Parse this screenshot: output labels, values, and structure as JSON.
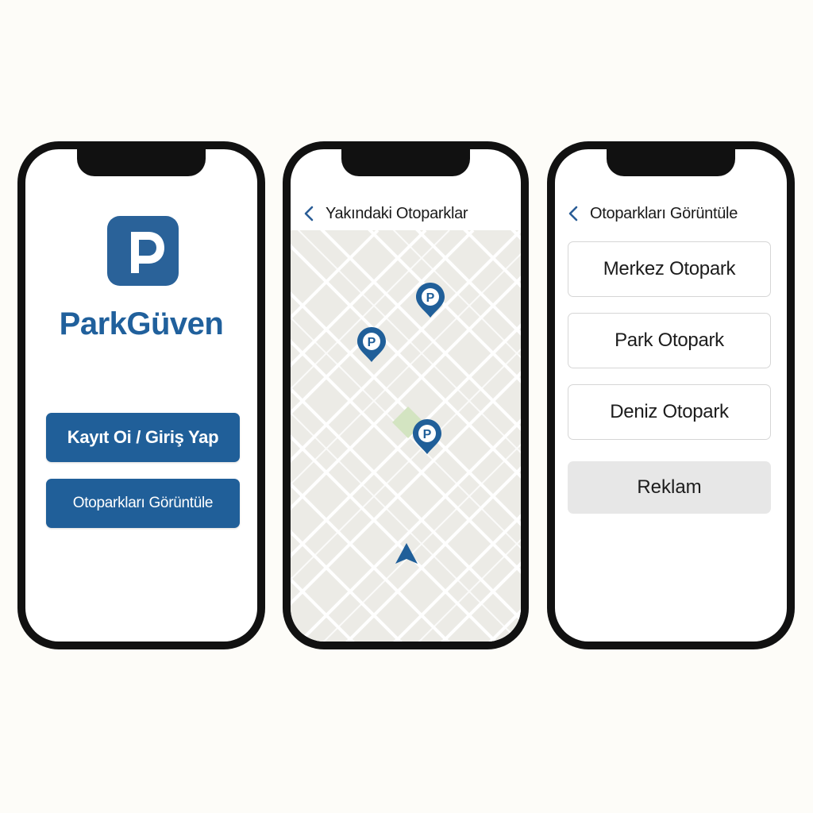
{
  "phone_home": {
    "brand": "ParkGüven",
    "login_button": "Kayıt Oi / Giriş Yap",
    "view_button": "Otoparkları Görüntüle",
    "logo_letter": "P"
  },
  "phone_map": {
    "title": "Yakındaki Otoparklar",
    "marker_letter": "P"
  },
  "phone_list": {
    "title": "Otoparkları Görüntüle",
    "lots": [
      "Merkez Otopark",
      "Park Otopark",
      "Deniz Otopark"
    ],
    "ad": "Reklam"
  },
  "colors": {
    "primary": "#205f99",
    "map_bg": "#ecebe6",
    "park_green": "#d3e4c1",
    "ad_bg": "#e7e7e7"
  },
  "icons": [
    "back-chevron-icon",
    "parking-marker-icon",
    "navigation-arrow-icon",
    "parking-logo-icon"
  ]
}
